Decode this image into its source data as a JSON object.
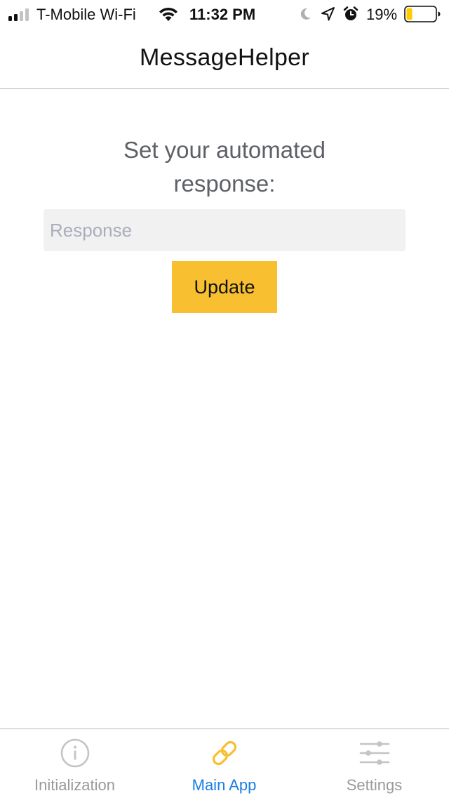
{
  "status_bar": {
    "carrier": "T-Mobile Wi-Fi",
    "time": "11:32 PM",
    "battery_percent": "19%",
    "battery_level": 0.19,
    "signal_bars_active": 2,
    "signal_bars_total": 4,
    "icons": [
      "signal-icon",
      "wifi-icon",
      "moon-icon",
      "location-arrow-icon",
      "alarm-icon",
      "battery-icon"
    ],
    "battery_fill_color": "#ffcc00"
  },
  "nav": {
    "title": "MessageHelper"
  },
  "main": {
    "prompt": "Set your automated response:",
    "response_input": {
      "placeholder": "Response",
      "value": ""
    },
    "update_label": "Update",
    "update_color": "#f8c030"
  },
  "tab_bar": {
    "tabs": [
      {
        "label": "Initialization",
        "icon": "info-icon",
        "selected": false
      },
      {
        "label": "Main App",
        "icon": "link-icon",
        "selected": true
      },
      {
        "label": "Settings",
        "icon": "sliders-icon",
        "selected": false
      }
    ],
    "selected_label_color": "#1a7ee6",
    "selected_icon_color": "#f8c030",
    "inactive_color": "#a0a0a0"
  }
}
